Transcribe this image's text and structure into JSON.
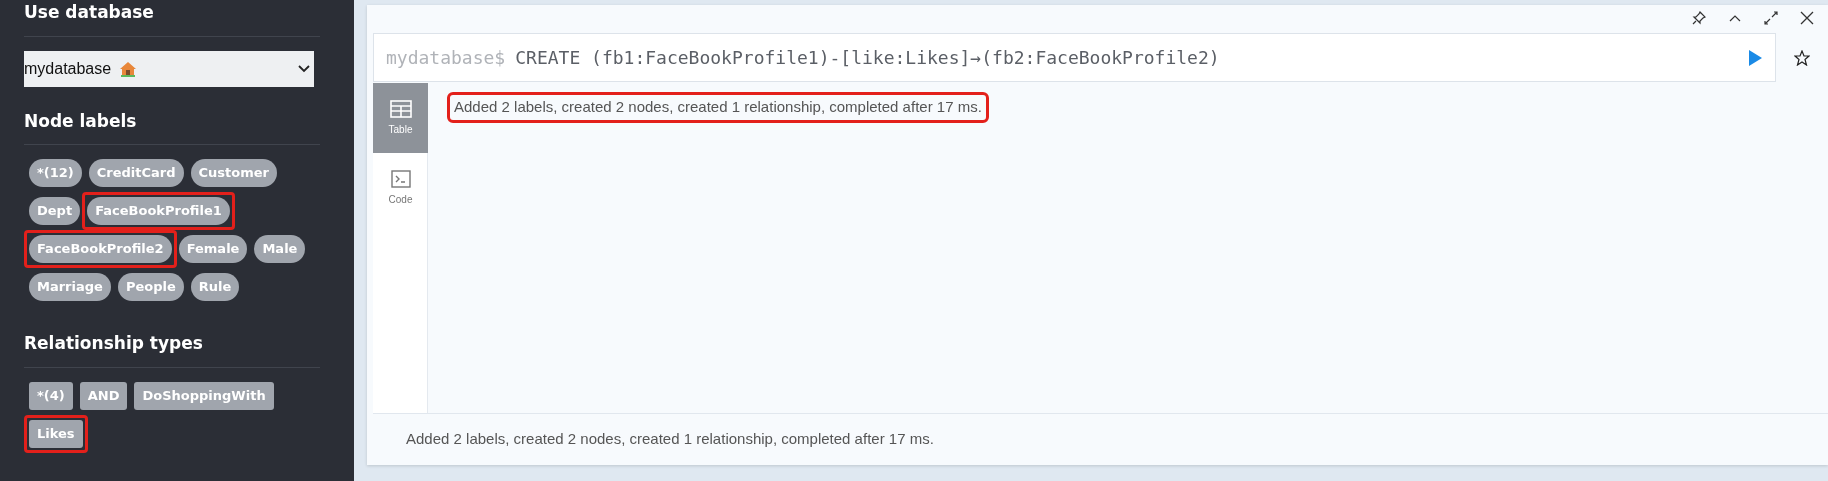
{
  "sidebar": {
    "database": {
      "heading": "Use database",
      "value": "mydatabase"
    },
    "node_labels": {
      "heading": "Node labels",
      "items": [
        {
          "label": "*(12)",
          "highlighted": false
        },
        {
          "label": "CreditCard",
          "highlighted": false
        },
        {
          "label": "Customer",
          "highlighted": false
        },
        {
          "label": "Dept",
          "highlighted": false
        },
        {
          "label": "FaceBookProfile1",
          "highlighted": true
        },
        {
          "label": "FaceBookProfile2",
          "highlighted": true
        },
        {
          "label": "Female",
          "highlighted": false
        },
        {
          "label": "Male",
          "highlighted": false
        },
        {
          "label": "Marriage",
          "highlighted": false
        },
        {
          "label": "People",
          "highlighted": false
        },
        {
          "label": "Rule",
          "highlighted": false
        }
      ]
    },
    "relationship_types": {
      "heading": "Relationship types",
      "items": [
        {
          "label": "*(4)",
          "highlighted": false
        },
        {
          "label": "AND",
          "highlighted": false
        },
        {
          "label": "DoShoppingWith",
          "highlighted": false
        },
        {
          "label": "Likes",
          "highlighted": true
        }
      ]
    }
  },
  "frame": {
    "prompt": "mydatabase$",
    "query": "CREATE (fb1:FaceBookProfile1)-[like:Likes]→(fb2:FaceBookProfile2)",
    "view_tabs": [
      {
        "label": "Table",
        "kind": "table",
        "selected": true
      },
      {
        "label": "Code",
        "kind": "code",
        "selected": false
      }
    ],
    "message": {
      "text": "Added 2 labels, created 2 nodes, created 1 relationship, completed after 17 ms.",
      "highlighted": true
    },
    "status": "Added 2 labels, created 2 nodes, created 1 relationship, completed after 17 ms."
  }
}
